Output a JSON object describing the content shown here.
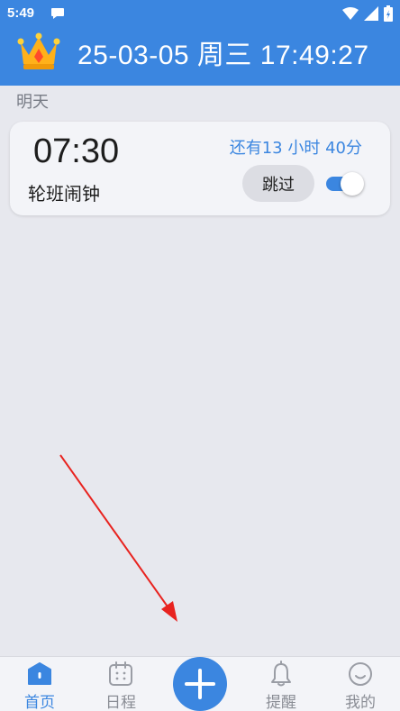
{
  "status_bar": {
    "time": "5:49"
  },
  "header": {
    "datetime": "25-03-05 周三 17:49:27"
  },
  "section": {
    "label": "明天"
  },
  "alarm": {
    "time": "07:30",
    "name": "轮班闹钟",
    "remaining": "还有13 小时 40分",
    "skip_label": "跳过",
    "enabled": true
  },
  "bottom_nav": {
    "home": "首页",
    "schedule": "日程",
    "reminder": "提醒",
    "mine": "我的"
  },
  "colors": {
    "accent": "#3b86e0",
    "background": "#e7e8ee",
    "card": "#f3f4f8",
    "arrow": "#e8231f"
  }
}
